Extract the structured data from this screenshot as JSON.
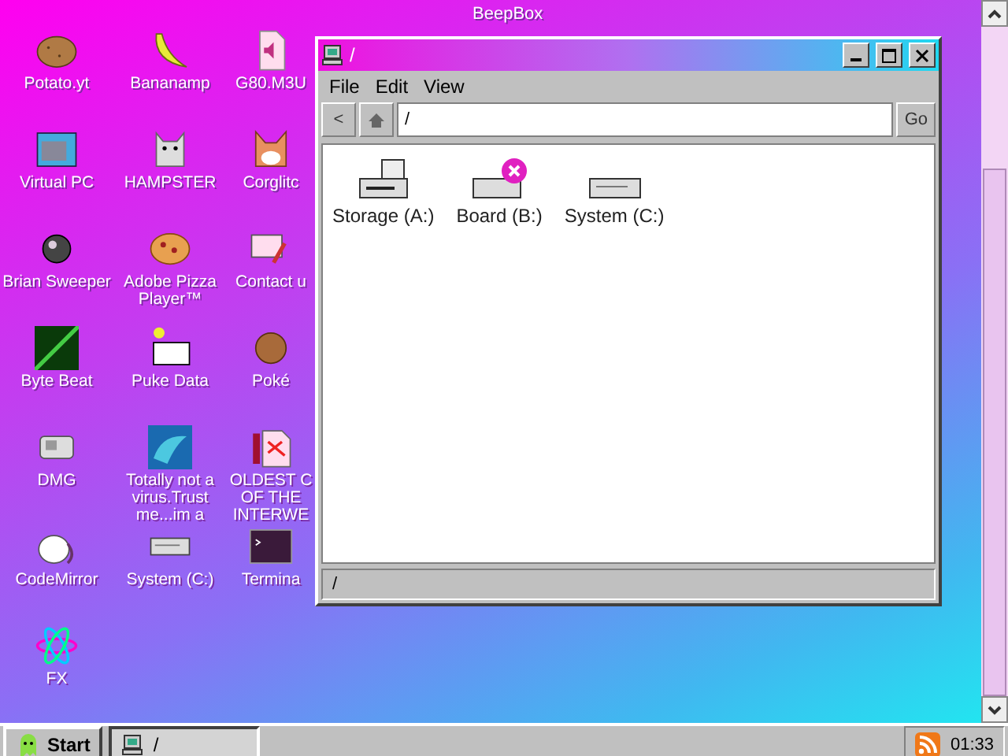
{
  "desktop": {
    "top_labels": [
      {
        "label": "BeepBox"
      }
    ],
    "icons": [
      {
        "label": "Potato.yt",
        "kind": "potato"
      },
      {
        "label": "Bananamp",
        "kind": "banana"
      },
      {
        "label": "G80.M3U",
        "kind": "audio-file"
      },
      {
        "label": "Virtual PC",
        "kind": "window"
      },
      {
        "label": "HAMPSTER",
        "kind": "hamster"
      },
      {
        "label": "Corglitc",
        "kind": "dog"
      },
      {
        "label": "Brian Sweeper",
        "kind": "mine"
      },
      {
        "label": "Adobe Pizza Player™",
        "kind": "pizza"
      },
      {
        "label": "Contact u",
        "kind": "mail"
      },
      {
        "label": "Byte Beat",
        "kind": "green-square"
      },
      {
        "label": "Puke Data",
        "kind": "pd"
      },
      {
        "label": "Poké",
        "kind": "cookie"
      },
      {
        "label": "DMG",
        "kind": "handheld"
      },
      {
        "label": "Totally not a virus.Trust me...im a",
        "kind": "dolphin"
      },
      {
        "label": "OLDEST C OF THE INTERWE",
        "kind": "document"
      },
      {
        "label": "CodeMirror",
        "kind": "mouse"
      },
      {
        "label": "System (C:)",
        "kind": "harddisk"
      },
      {
        "label": "Termina",
        "kind": "terminal"
      },
      {
        "label": "FX",
        "kind": "atom"
      }
    ]
  },
  "window": {
    "title": "/",
    "menu": [
      "File",
      "Edit",
      "View"
    ],
    "address": {
      "back": "<",
      "value": "/",
      "go": "Go"
    },
    "drives": [
      {
        "label": "Storage (A:)",
        "kind": "floppy"
      },
      {
        "label": "Board (B:)",
        "kind": "error"
      },
      {
        "label": "System (C:)",
        "kind": "harddisk"
      }
    ],
    "status_bar": "/"
  },
  "taskbar": {
    "start": "Start",
    "tasks": [
      {
        "label": "/",
        "selected": true
      }
    ],
    "clock": "01:33"
  }
}
